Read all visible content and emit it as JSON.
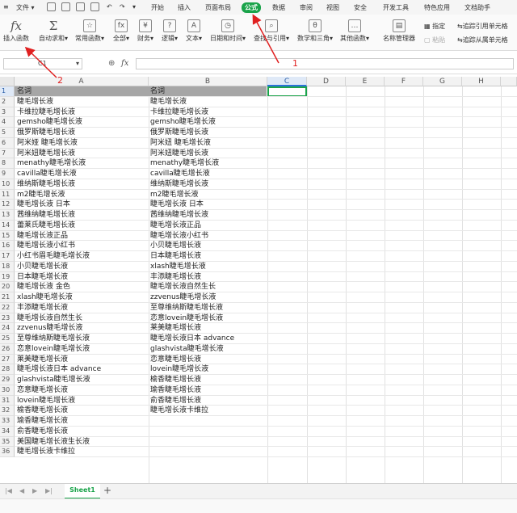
{
  "menubar": {
    "file": "文件",
    "tabs": [
      "开始",
      "插入",
      "页面布局",
      "公式",
      "数据",
      "审阅",
      "视图",
      "安全",
      "开发工具",
      "特色应用",
      "文档助手"
    ],
    "active_tab": "公式"
  },
  "ribbon": {
    "insert_function": "插入函数",
    "autosum": "自动求和",
    "common_functions": "常用函数",
    "all": "全部",
    "finance": "财务",
    "logic": "逻辑",
    "text": "文本",
    "datetime": "日期和时间",
    "lookup": "查找与引用",
    "math_trig": "数学和三角",
    "other_functions": "其他函数",
    "name_manager": "名称管理器",
    "designate": "指定",
    "paste": "粘贴",
    "trace_precedents": "追踪引用单元格",
    "trace_dependents": "追踪从属单元格"
  },
  "formula_bar": {
    "name_box": "C1",
    "fx": "fx",
    "value": ""
  },
  "grid": {
    "columns": [
      "A",
      "B",
      "C",
      "D",
      "E",
      "F",
      "G",
      "H"
    ],
    "selected_column": "C",
    "selected_row": 1,
    "row_numbers": [
      "1",
      "2",
      "3",
      "4",
      "5",
      "6",
      "7",
      "8",
      "9",
      "10",
      "11",
      "12",
      "13",
      "14",
      "15",
      "16",
      "17",
      "18",
      "19",
      "20",
      "21",
      "22",
      "23",
      "24",
      "25",
      "26",
      "27",
      "28",
      "29",
      "30",
      "31",
      "32",
      "33",
      "34",
      "35",
      "36"
    ],
    "col_a": [
      "名词",
      "睫毛增长液",
      "卡维拉睫毛增长液",
      "gemsho睫毛增长液",
      "俄罗斯睫毛增长液",
      "阿米娅 睫毛增长液",
      "阿米妞睫毛增长液",
      "menathy睫毛增长液",
      "cavilla睫毛增长液",
      "维纳斯睫毛增长液",
      "m2睫毛增长液",
      "睫毛增长液 日本",
      "茜维纳睫毛增长液",
      "蕾莱氏睫毛增长液",
      "睫毛增长液正品",
      "睫毛增长液小红书",
      "小红书眉毛睫毛增长液",
      "小贝睫毛增长液",
      "日本睫毛增长液",
      "睫毛增长液 金色",
      "xlash睫毛增长液",
      "丰添睫毛增长液",
      "睫毛增长液自然生长",
      "zzvenus睫毛增长液",
      "至尊维纳斯睫毛增长液",
      "恋意lovein睫毛增长液",
      "莱美睫毛增长液",
      "睫毛增长液日本 advance",
      "glashvista睫毛增长液",
      "恋意睫毛增长液",
      "lovein睫毛增长液",
      "榆香睫毛增长液",
      "瑜香睫毛增长液",
      "俞香睫毛增长液",
      "美国睫毛增长液生长液",
      "睫毛增长液卡维拉"
    ],
    "col_b": [
      "名词",
      "睫毛增长液",
      "卡维拉睫毛增长液",
      "gemsho睫毛增长液",
      "俄罗斯睫毛增长液",
      "阿米妞 睫毛增长液",
      "阿米妞睫毛增长液",
      "menathy睫毛增长液",
      "cavilla睫毛增长液",
      "维纳斯睫毛增长液",
      "m2睫毛增长液",
      "睫毛增长液 日本",
      "茜维纳睫毛增长液",
      "睫毛增长液正品",
      "睫毛增长液小红书",
      "小贝睫毛增长液",
      "日本睫毛增长液",
      "xlash睫毛增长液",
      "丰添睫毛增长液",
      "睫毛增长液自然生长",
      "zzvenus睫毛增长液",
      "至尊维纳斯睫毛增长液",
      "恋意lovein睫毛增长液",
      "莱美睫毛增长液",
      "睫毛增长液日本 advance",
      "glashvista睫毛增长液",
      "恋意睫毛增长液",
      "lovein睫毛增长液",
      "榆香睫毛增长液",
      "瑜香睫毛增长液",
      "俞香睫毛增长液",
      "睫毛增长液卡维拉"
    ]
  },
  "sheets": {
    "tabs": [
      "Sheet1"
    ],
    "add": "+"
  },
  "annotations": {
    "label_1": "1",
    "label_2": "2",
    "color": "#e02020"
  }
}
